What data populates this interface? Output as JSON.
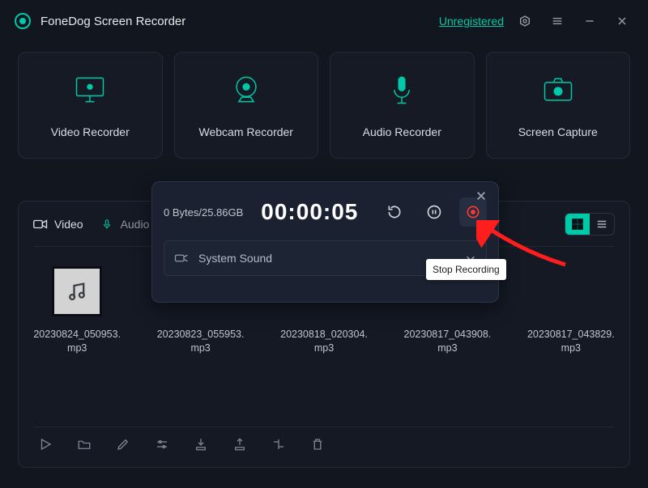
{
  "titlebar": {
    "app_title": "FoneDog Screen Recorder",
    "unregistered_label": "Unregistered"
  },
  "modes": [
    {
      "id": "video",
      "label": "Video Recorder"
    },
    {
      "id": "webcam",
      "label": "Webcam Recorder"
    },
    {
      "id": "audio",
      "label": "Audio Recorder"
    },
    {
      "id": "capture",
      "label": "Screen Capture"
    }
  ],
  "library": {
    "tabs": {
      "video_label": "Video",
      "audio_label": "Audio"
    },
    "files": [
      {
        "name": "20230824_050953.mp3",
        "highlight": true
      },
      {
        "name": "20230823_055953.mp3",
        "highlight": false
      },
      {
        "name": "20230818_020304.mp3",
        "highlight": false
      },
      {
        "name": "20230817_043908.mp3",
        "highlight": false
      },
      {
        "name": "20230817_043829.mp3",
        "highlight": false
      }
    ]
  },
  "rec_panel": {
    "size_text": "0 Bytes/25.86GB",
    "timer": "00:00:05",
    "source_label": "System Sound",
    "tooltip": "Stop Recording"
  },
  "colors": {
    "accent": "#00c9a7",
    "record": "#ff3b30",
    "bg": "#12161f"
  }
}
